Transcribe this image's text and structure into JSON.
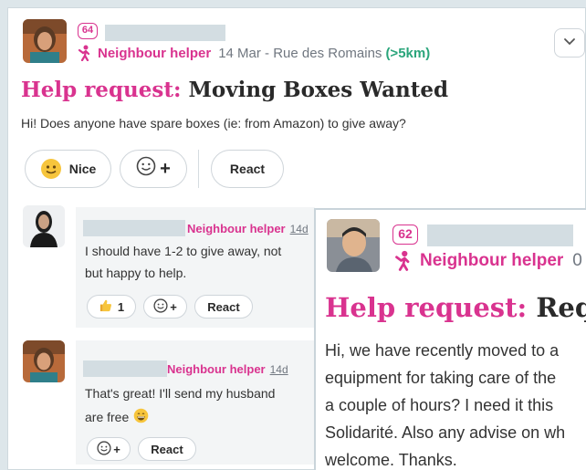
{
  "post": {
    "badge": "64",
    "helper_label": "Neighbour helper",
    "date": "14 Mar - Rue des Romains",
    "distance": "(>5km)",
    "title_category": "Help request:",
    "title_text": "Moving Boxes Wanted",
    "body": "Hi! Does anyone have spare boxes (ie: from Amazon) to give away?",
    "reactions": {
      "nice_label": "Nice",
      "add_reaction_label": "+",
      "react_label": "React"
    }
  },
  "comments": [
    {
      "helper_label": "Neighbour helper",
      "time": "14d",
      "text_line1": "I should have 1-2 to give away, not",
      "text_line2": "but happy to help.",
      "like_count": "1",
      "add_reaction_label": "+",
      "react_label": "React"
    },
    {
      "helper_label": "Neighbour helper",
      "time": "14d",
      "text_line1": "That's great! I'll send my husband",
      "text_line2": "are free",
      "add_reaction_label": "+",
      "react_label": "React"
    }
  ],
  "overlay_post": {
    "badge": "62",
    "helper_label": "Neighbour helper",
    "date_fragment": "0",
    "title_category": "Help request:",
    "title_text": "Reque",
    "lines": [
      "Hi, we have recently moved to a",
      "equipment for taking care of the",
      "a couple of hours? I need it this",
      "Solidarité. Also any advise on wh",
      "welcome. Thanks."
    ]
  },
  "colors": {
    "accent": "#d9338f",
    "distance": "#2aa57b",
    "redaction": "#d3dde2"
  },
  "icons": [
    "helper-person-icon",
    "chevron-down-icon",
    "smiley-emoji-icon",
    "add-reaction-icon",
    "thumbs-up-icon",
    "grinning-emoji-icon"
  ]
}
